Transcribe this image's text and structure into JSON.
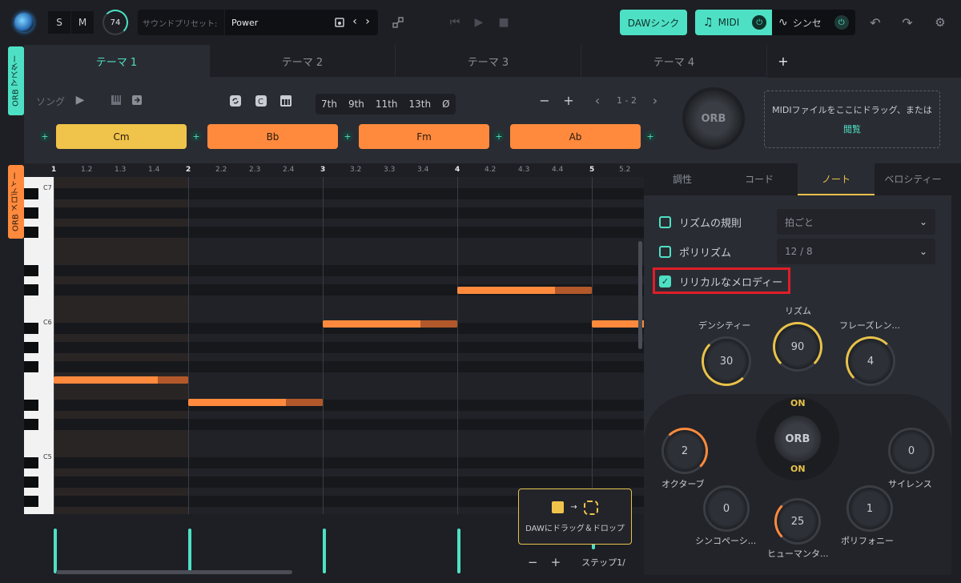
{
  "topbar": {
    "solo": "S",
    "mute": "M",
    "volume": "74",
    "preset_label": "サウンドプリセット:",
    "preset_name": "Power",
    "daw_sync": "DAWシンク",
    "midi": "MIDI",
    "synth": "シンセ"
  },
  "side_tabs": {
    "master": "ORB マスター",
    "melody": "ORB メロディー"
  },
  "themes": {
    "tabs": [
      "テーマ 1",
      "テーマ 2",
      "テーマ 3",
      "テーマ 4"
    ],
    "add": "+"
  },
  "master": {
    "song_label": "ソング",
    "extensions": [
      "7th",
      "9th",
      "11th",
      "13th",
      "Ø"
    ],
    "pager": "1 - 2",
    "minus": "−",
    "plus": "+",
    "chords": [
      "Cm",
      "Bb",
      "Fm",
      "Ab"
    ],
    "orb": "ORB",
    "drop_text": "MIDIファイルをここにドラッグ、または",
    "drop_link": "閲覧"
  },
  "melody": {
    "ruler": [
      "1",
      "1.2",
      "1.3",
      "1.4",
      "2",
      "2.2",
      "2.3",
      "2.4",
      "3",
      "3.2",
      "3.3",
      "3.4",
      "4",
      "4.2",
      "4.3",
      "4.4",
      "5",
      "5.2"
    ],
    "octave_labels": [
      "C7",
      "C6",
      "C5"
    ],
    "drag_tip": "DAWにドラッグ＆ドロップ",
    "zoom_minus": "−",
    "zoom_plus": "+",
    "step": "ステップ1/"
  },
  "right": {
    "tabs": [
      "調性",
      "コード",
      "ノート",
      "ベロシティー"
    ],
    "options": [
      {
        "label": "リズムの規則",
        "value": "拍ごと",
        "checked": false
      },
      {
        "label": "ポリリズム",
        "value": "12 / 8",
        "checked": false
      },
      {
        "label": "リリカルなメロディー",
        "checked": true
      }
    ],
    "knobs": {
      "density": {
        "label": "デンシティー",
        "value": "30"
      },
      "rhythm": {
        "label": "リズム",
        "value": "90"
      },
      "phrase": {
        "label": "フレーズレン...",
        "value": "4"
      },
      "octave": {
        "label": "オクターブ",
        "value": "2"
      },
      "silence": {
        "label": "サイレンス",
        "value": "0"
      },
      "syncopation": {
        "label": "シンコペーシ...",
        "value": "0"
      },
      "humanize": {
        "label": "ヒューマンタ...",
        "value": "25"
      },
      "polyphony": {
        "label": "ポリフォニー",
        "value": "1"
      }
    },
    "orb_center": "ORB",
    "on_top": "ON",
    "on_bottom": "ON"
  },
  "colors": {
    "accent": "#4ee0c4",
    "chord_active": "#f0c44a",
    "chord": "#ff8a3d",
    "highlight": "#e01e28"
  }
}
